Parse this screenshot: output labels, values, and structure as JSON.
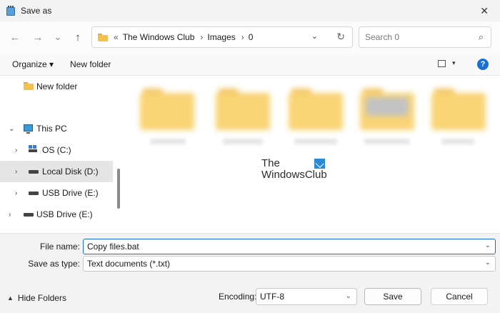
{
  "window": {
    "title": "Save as",
    "close_glyph": "✕"
  },
  "nav": {
    "back": "←",
    "forward": "→",
    "recent": "⌄",
    "up": "↑"
  },
  "address": {
    "prefix": "«",
    "crumbs": [
      "The Windows Club",
      "Images",
      "0"
    ],
    "separator": "›",
    "dropdown": "⌄",
    "refresh": "↻"
  },
  "search": {
    "placeholder": "Search 0",
    "icon": "⌕"
  },
  "toolbar": {
    "organize": "Organize ▾",
    "new_folder": "New folder",
    "help": "?",
    "view_dd": "▾"
  },
  "sidebar": {
    "items": [
      {
        "label": "New folder",
        "icon": "folder-icon"
      },
      {
        "label": "This PC",
        "icon": "pc-icon",
        "chevron": "⌄"
      },
      {
        "label": "OS (C:)",
        "icon": "windows-drive-icon",
        "chevron": "›"
      },
      {
        "label": "Local Disk (D:)",
        "icon": "drive-icon",
        "chevron": "›",
        "selected": true
      },
      {
        "label": "USB Drive (E:)",
        "icon": "drive-icon",
        "chevron": "›"
      },
      {
        "label": "USB Drive (E:)",
        "icon": "drive-icon",
        "chevron": "›"
      }
    ]
  },
  "watermark": {
    "line1": "The",
    "line2": "WindowsClub"
  },
  "form": {
    "file_name_label": "File name:",
    "file_name_value": "Copy files.bat",
    "save_type_label": "Save as type:",
    "save_type_value": "Text documents (*.txt)",
    "dropdown": "⌄"
  },
  "footer": {
    "hide_folders": "Hide Folders",
    "hide_caret": "▲",
    "encoding_label": "Encoding:",
    "encoding_value": "UTF-8",
    "save": "Save",
    "cancel": "Cancel"
  },
  "colors": {
    "accent": "#1a6fd4",
    "folder": "#f4c14f",
    "selected": "#e5e5e5"
  }
}
